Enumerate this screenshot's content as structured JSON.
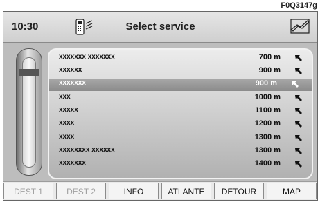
{
  "ref": "F0Q3147g",
  "header": {
    "time": "10:30",
    "title": "Select service",
    "phone_icon": "phone-signal-icon",
    "nav_icon": "navigation-map-icon"
  },
  "list": [
    {
      "name": "xxxxxxx xxxxxxx",
      "dist": "700 m",
      "selected": false
    },
    {
      "name": "xxxxxx",
      "dist": "900 m",
      "selected": false
    },
    {
      "name": "xxxxxxx",
      "dist": "900 m",
      "selected": true
    },
    {
      "name": "xxx",
      "dist": "1000 m",
      "selected": false
    },
    {
      "name": "xxxxx",
      "dist": "1100 m",
      "selected": false
    },
    {
      "name": "xxxx",
      "dist": "1200 m",
      "selected": false
    },
    {
      "name": "xxxx",
      "dist": "1300 m",
      "selected": false
    },
    {
      "name": "xxxxxxxx xxxxxx",
      "dist": "1300 m",
      "selected": false
    },
    {
      "name": "xxxxxxx",
      "dist": "1400 m",
      "selected": false
    }
  ],
  "footer": [
    {
      "label": "DEST 1",
      "enabled": false
    },
    {
      "label": "DEST 2",
      "enabled": false
    },
    {
      "label": "INFO",
      "enabled": true
    },
    {
      "label": "ATLANTE",
      "enabled": true
    },
    {
      "label": "DETOUR",
      "enabled": true
    },
    {
      "label": "MAP",
      "enabled": true
    }
  ]
}
